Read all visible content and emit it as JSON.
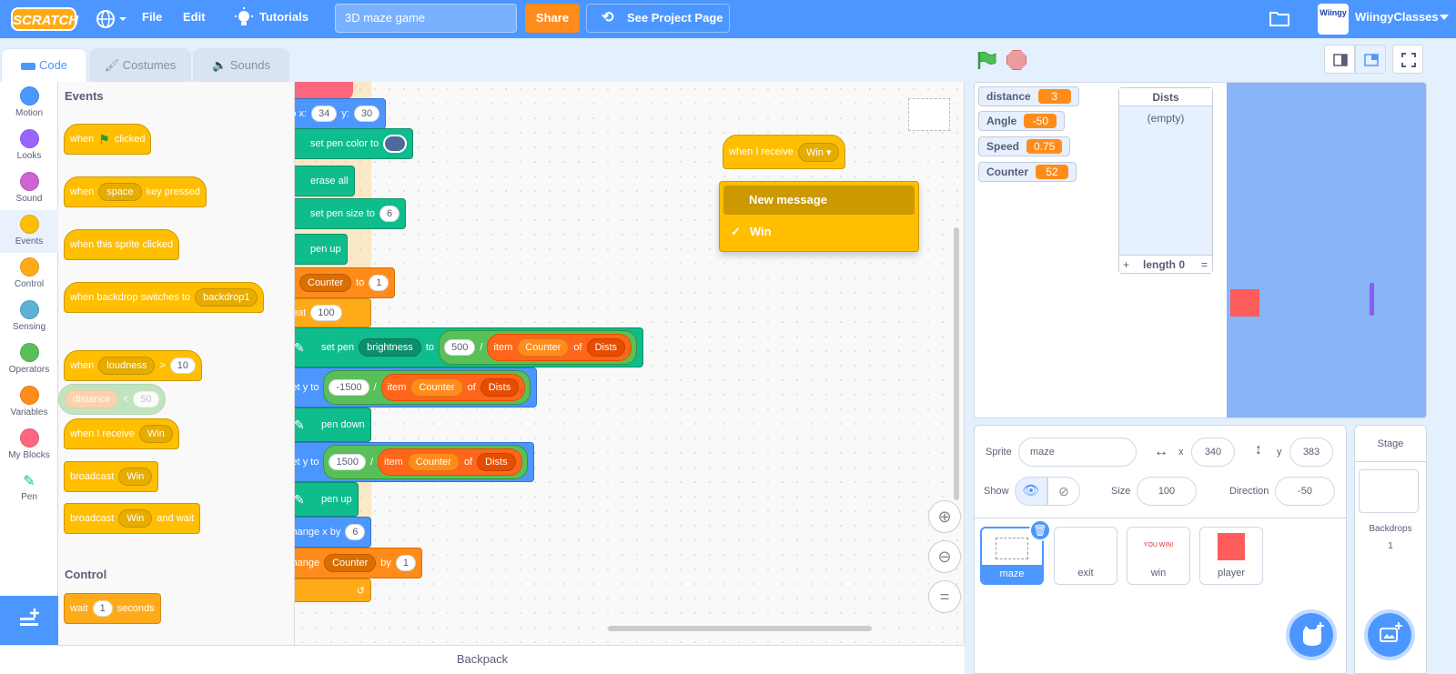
{
  "menubar": {
    "logo": "SCRATCH",
    "file": "File",
    "edit": "Edit",
    "tutorials": "Tutorials",
    "project_title": "3D maze game",
    "share": "Share",
    "see_project": "See Project Page",
    "username": "WiingyClasses",
    "avatar_text": "Wiingy"
  },
  "tabs": {
    "code": "Code",
    "costumes": "Costumes",
    "sounds": "Sounds"
  },
  "categories": [
    {
      "label": "Motion",
      "color": "#4c97ff"
    },
    {
      "label": "Looks",
      "color": "#9966ff"
    },
    {
      "label": "Sound",
      "color": "#cf63cf"
    },
    {
      "label": "Events",
      "color": "#ffbf00"
    },
    {
      "label": "Control",
      "color": "#ffab19"
    },
    {
      "label": "Sensing",
      "color": "#5cb1d6"
    },
    {
      "label": "Operators",
      "color": "#59c059"
    },
    {
      "label": "Variables",
      "color": "#ff8c1a"
    },
    {
      "label": "My Blocks",
      "color": "#ff6680"
    },
    {
      "label": "Pen",
      "color": "#0fbd8c"
    }
  ],
  "palette": {
    "events_heading": "Events",
    "when_flag": {
      "a": "when",
      "b": "clicked"
    },
    "when_key": {
      "a": "when",
      "key": "space",
      "b": "key pressed"
    },
    "when_sprite_clicked": "when this sprite clicked",
    "when_backdrop": {
      "a": "when backdrop switches to",
      "b": "backdrop1"
    },
    "when_loudness": {
      "a": "when",
      "b": "loudness",
      "op": ">",
      "v": "10"
    },
    "ghost_distance": {
      "a": "distance",
      "op": "<",
      "v": "50"
    },
    "when_receive": {
      "a": "when I receive",
      "b": "Win"
    },
    "broadcast": {
      "a": "broadcast",
      "b": "Win"
    },
    "broadcast_wait": {
      "a": "broadcast",
      "b": "Win",
      "c": "and wait"
    },
    "control_heading": "Control",
    "wait": {
      "a": "wait",
      "v": "1",
      "b": "seconds"
    }
  },
  "script": {
    "goto": {
      "a": "go to x:",
      "x": "34",
      "b": "y:",
      "y": "30"
    },
    "set_pen_color": "set pen color to",
    "erase_all": "erase all",
    "set_pen_size": {
      "a": "set pen size to",
      "v": "6"
    },
    "pen_up_1": "pen up",
    "set_counter": {
      "var": "Counter",
      "a": "to",
      "v": "1"
    },
    "repeat": {
      "a": "repeat",
      "v": "100"
    },
    "set_pen_brightness": {
      "a": "set pen",
      "param": "brightness",
      "b": "to",
      "v": "500",
      "div": "/",
      "item": "item",
      "idx": "Counter",
      "of": "of",
      "list": "Dists"
    },
    "set_y_1": {
      "a": "set y to",
      "v": "-1500",
      "div": "/",
      "item": "item",
      "idx": "Counter",
      "of": "of",
      "list": "Dists"
    },
    "pen_down": "pen down",
    "set_y_2": {
      "a": "set y to",
      "v": "1500",
      "div": "/",
      "item": "item",
      "idx": "Counter",
      "of": "of",
      "list": "Dists"
    },
    "pen_up_2": "pen up",
    "change_x": {
      "a": "change x by",
      "v": "6"
    },
    "change_counter": {
      "a": "change",
      "var": "Counter",
      "b": "by",
      "v": "1"
    },
    "loop_arrow": "↺",
    "receive_hat": {
      "a": "when I receive",
      "b": "Win"
    },
    "dropdown": {
      "new": "New message",
      "check": "✓",
      "win": "Win"
    }
  },
  "backpack": "Backpack",
  "stage": {
    "monitors": [
      {
        "name": "distance",
        "value": "3"
      },
      {
        "name": "Angle",
        "value": "-50"
      },
      {
        "name": "Speed",
        "value": "0.75"
      },
      {
        "name": "Counter",
        "value": "52"
      }
    ],
    "list": {
      "title": "Dists",
      "empty": "(empty)",
      "plus": "+",
      "length": "length 0",
      "eq": "="
    },
    "colors": {
      "sky": "#89b4f8",
      "player": "#ff5c5c",
      "wall": "#8a5cf0"
    }
  },
  "sprite_info": {
    "sprite_label": "Sprite",
    "name": "maze",
    "x_label": "x",
    "x": "340",
    "y_label": "y",
    "y": "383",
    "show_label": "Show",
    "size_label": "Size",
    "size": "100",
    "direction_label": "Direction",
    "direction": "-50"
  },
  "sprites": [
    {
      "name": "maze"
    },
    {
      "name": "exit"
    },
    {
      "name": "win",
      "thumb_text": "YOU WIN!"
    },
    {
      "name": "player"
    }
  ],
  "stage_pane": {
    "title": "Stage",
    "backdrops_label": "Backdrops",
    "backdrops_count": "1"
  }
}
